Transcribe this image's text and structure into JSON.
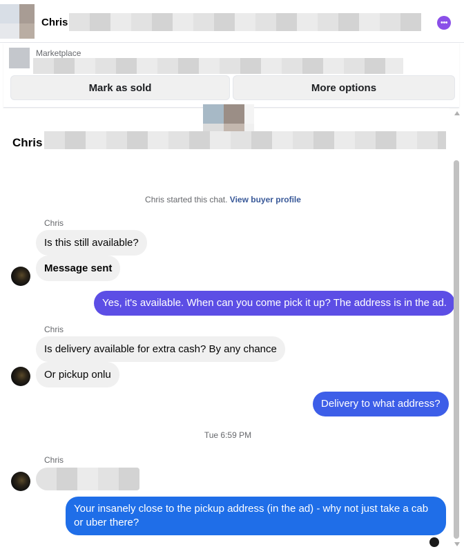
{
  "header": {
    "name": "Chris ·",
    "more_icon": "ellipsis-icon",
    "more_glyph": "•••",
    "accent": "#8a4fe8"
  },
  "marketplace": {
    "label": "Marketplace",
    "mark_sold_label": "Mark as sold",
    "more_options_label": "More options"
  },
  "chat": {
    "title": "Chris ·",
    "started_text": "Chris started this chat.",
    "view_profile_label": "View buyer profile",
    "sender_name": "Chris",
    "timestamp": "Tue 6:59 PM",
    "messages": [
      {
        "from": "buyer",
        "text": "Is this still available?"
      },
      {
        "from": "buyer",
        "text": "Message sent"
      },
      {
        "from": "seller",
        "text": "Yes, it's available. When can you come pick it up? The address is in the ad."
      },
      {
        "from": "buyer",
        "text": "Is delivery available for extra cash? By any chance"
      },
      {
        "from": "buyer",
        "text": "Or pickup onlu"
      },
      {
        "from": "seller",
        "text": "Delivery to what address?"
      },
      {
        "from": "seller",
        "text": "Your insanely close to the pickup address (in the ad) - why not just take a cab or uber there?"
      }
    ]
  },
  "colors": {
    "outgoing_purple": "#5c4ee5",
    "outgoing_blue": "#1f6ee8",
    "incoming_bg": "#f0f0f0",
    "link": "#385898"
  }
}
